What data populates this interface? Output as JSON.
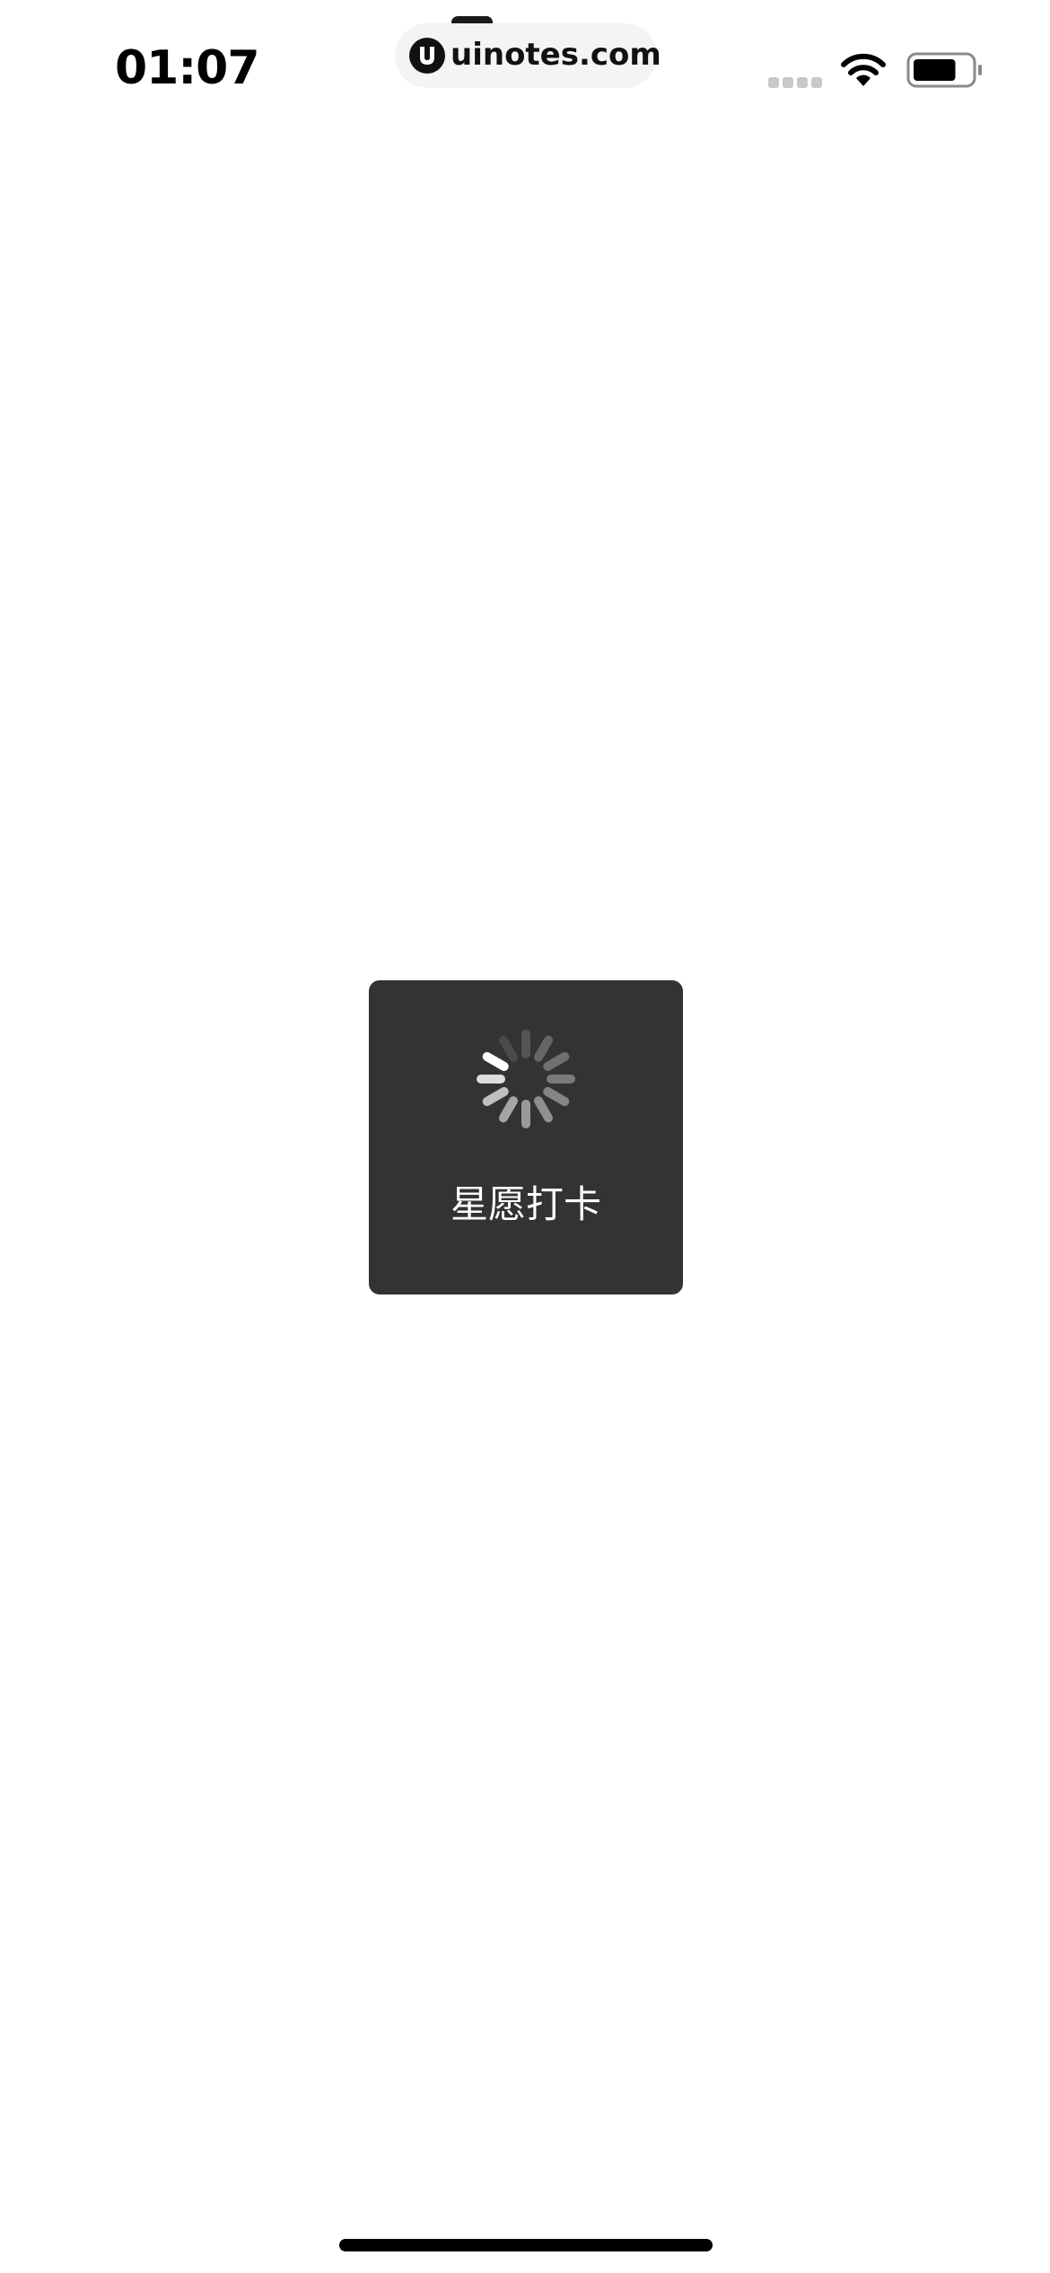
{
  "status_bar": {
    "time": "01:07",
    "url": "uinotes.com",
    "icons": {
      "logo": "uinotes-logo-icon",
      "signal": "cellular-signal-icon",
      "wifi": "wifi-icon",
      "battery": "battery-icon"
    },
    "battery_level": 0.75
  },
  "loading_toast": {
    "label": "星愿打卡",
    "icon": "loading-spinner-icon",
    "background": "#333333"
  },
  "colors": {
    "background": "#ffffff",
    "text": "#000000",
    "toast_text": "#ffffff"
  }
}
